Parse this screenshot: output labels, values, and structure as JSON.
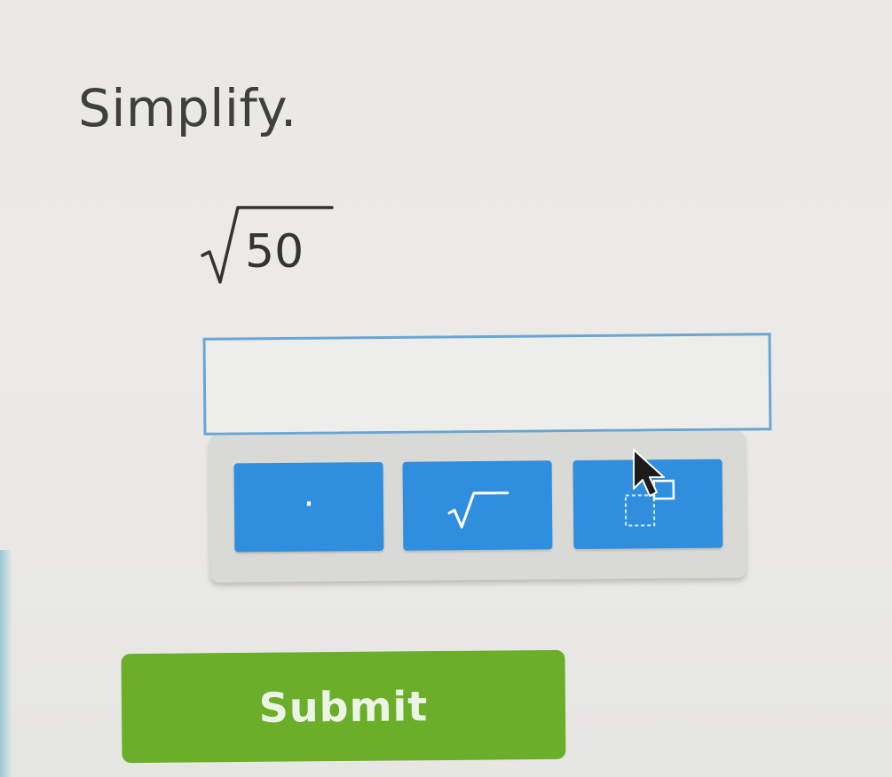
{
  "prompt": "Simplify.",
  "expression": {
    "radicand": "50"
  },
  "answer": {
    "value": ""
  },
  "keypad": {
    "keys": [
      {
        "label": "·",
        "icon": "dot-key-icon"
      },
      {
        "label": "",
        "icon": "square-root-icon"
      },
      {
        "label": "",
        "icon": "exponent-icon"
      }
    ]
  },
  "submit": {
    "label": "Submit"
  },
  "colors": {
    "key_blue": "#2f8fde",
    "submit_green": "#6aae2a",
    "input_border": "#6aa5d6"
  }
}
